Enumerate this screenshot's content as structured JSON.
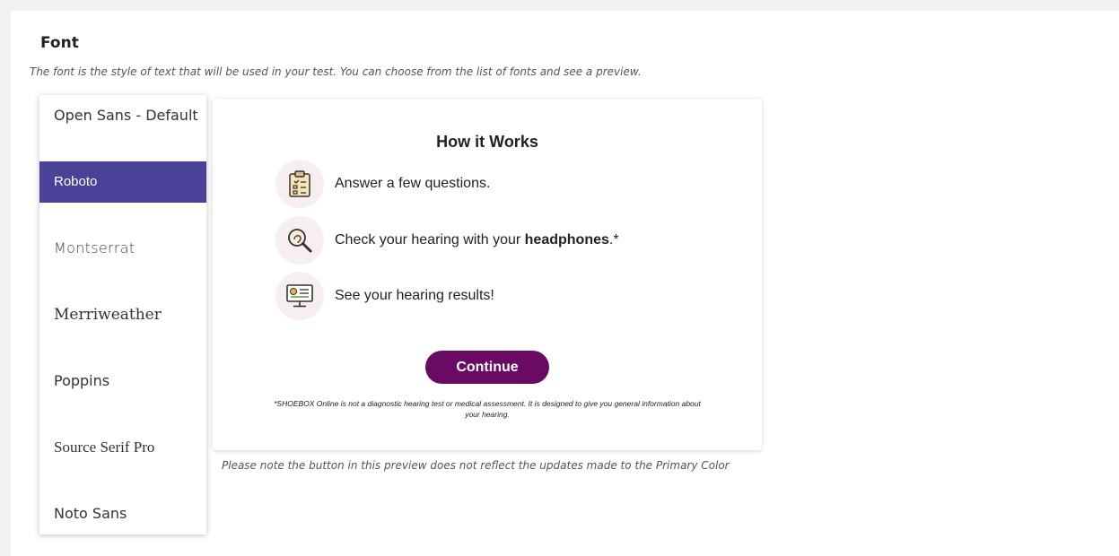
{
  "section": {
    "title": "Font",
    "description": "The font is the style of text that will be used in your test. You can choose from the list of fonts and see a preview."
  },
  "fonts": [
    {
      "label": "Open Sans - Default",
      "selected": false
    },
    {
      "label": "Roboto",
      "selected": true
    },
    {
      "label": "Montserrat",
      "selected": false
    },
    {
      "label": "Merriweather",
      "selected": false
    },
    {
      "label": "Poppins",
      "selected": false
    },
    {
      "label": "Source Serif Pro",
      "selected": false
    },
    {
      "label": "Noto Sans",
      "selected": false
    }
  ],
  "preview": {
    "title": "How it Works",
    "steps": [
      {
        "icon": "clipboard-icon",
        "text": "Answer a few questions."
      },
      {
        "icon": "ear-magnifier-icon",
        "text_before": "Check your hearing with your ",
        "text_bold": "headphones",
        "text_after": ".*"
      },
      {
        "icon": "monitor-results-icon",
        "text": "See your hearing results!"
      }
    ],
    "button_label": "Continue",
    "disclaimer": "*SHOEBOX Online is not a diagnostic hearing test or medical assessment. It is designed to give you general information about your hearing."
  },
  "preview_note": "Please note the button in this preview does not reflect the updates made to the Primary Color",
  "colors": {
    "selected_font_bg": "#4a4198",
    "continue_button": "#6a0b63",
    "icon_circle": "#f7eef2"
  }
}
